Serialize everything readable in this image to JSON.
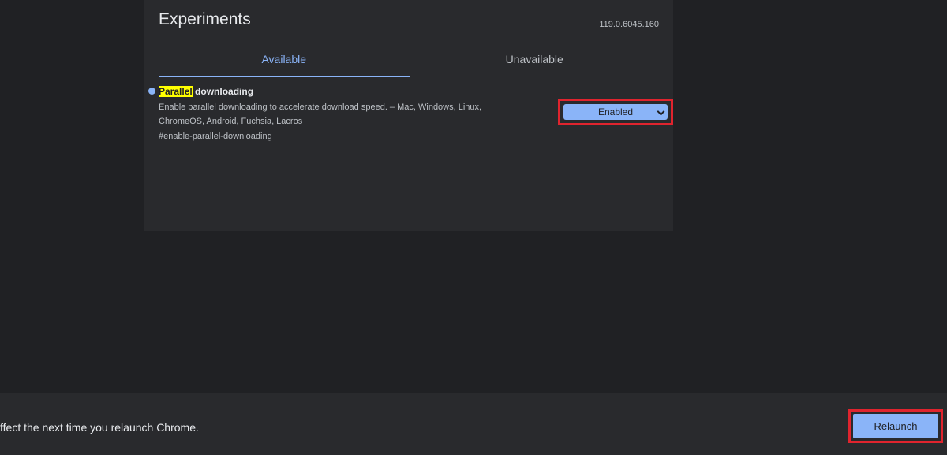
{
  "header": {
    "title": "Experiments",
    "version": "119.0.6045.160"
  },
  "tabs": [
    {
      "label": "Available",
      "active": true
    },
    {
      "label": "Unavailable",
      "active": false
    }
  ],
  "experiment": {
    "name_highlight": "Parallel",
    "name_rest": " downloading",
    "description": "Enable parallel downloading to accelerate download speed. – Mac, Windows, Linux, ChromeOS, Android, Fuchsia, Lacros",
    "link": "#enable-parallel-downloading",
    "selected_option": "Enabled"
  },
  "bottom": {
    "message": "ffect the next time you relaunch Chrome.",
    "relaunch_label": "Relaunch"
  },
  "colors": {
    "accent": "#8ab4f8",
    "annotation": "#e0242e",
    "highlight": "#ffff00"
  }
}
